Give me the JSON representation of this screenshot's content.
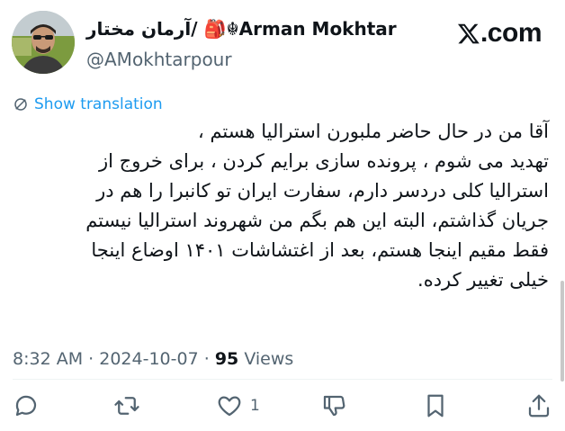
{
  "author": {
    "display_name": "آرمان مختار/ 🎒☬Arman Mokhtar",
    "handle": "@AMokhtarpour"
  },
  "brand": {
    "label": ".com"
  },
  "translation_link": "Show translation",
  "tweet": {
    "lines": [
      "آقا من در حال حاضر ملبورن استرالیا هستم ،",
      "تهدید می شوم ، پرونده سازی برایم کردن ، برای خروج از",
      "استرالیا کلی دردسر دارم، سفارت ایران تو کانبرا را هم در",
      "جریان گذاشتم، البته این هم بگم من شهروند استرالیا نیستم",
      "فقط مقیم اینجا هستم، بعد از اغتشاشات ۱۴۰۱ اوضاع اینجا",
      "خیلی تغییر کرده."
    ]
  },
  "meta": {
    "time": "8:32 AM",
    "separator": "·",
    "date": "2024-10-07",
    "views_count": "95",
    "views_label": "Views"
  },
  "actions": {
    "like_count": "1"
  },
  "colors": {
    "accent": "#1d9bf0",
    "muted": "#536471",
    "text": "#0f1419"
  }
}
